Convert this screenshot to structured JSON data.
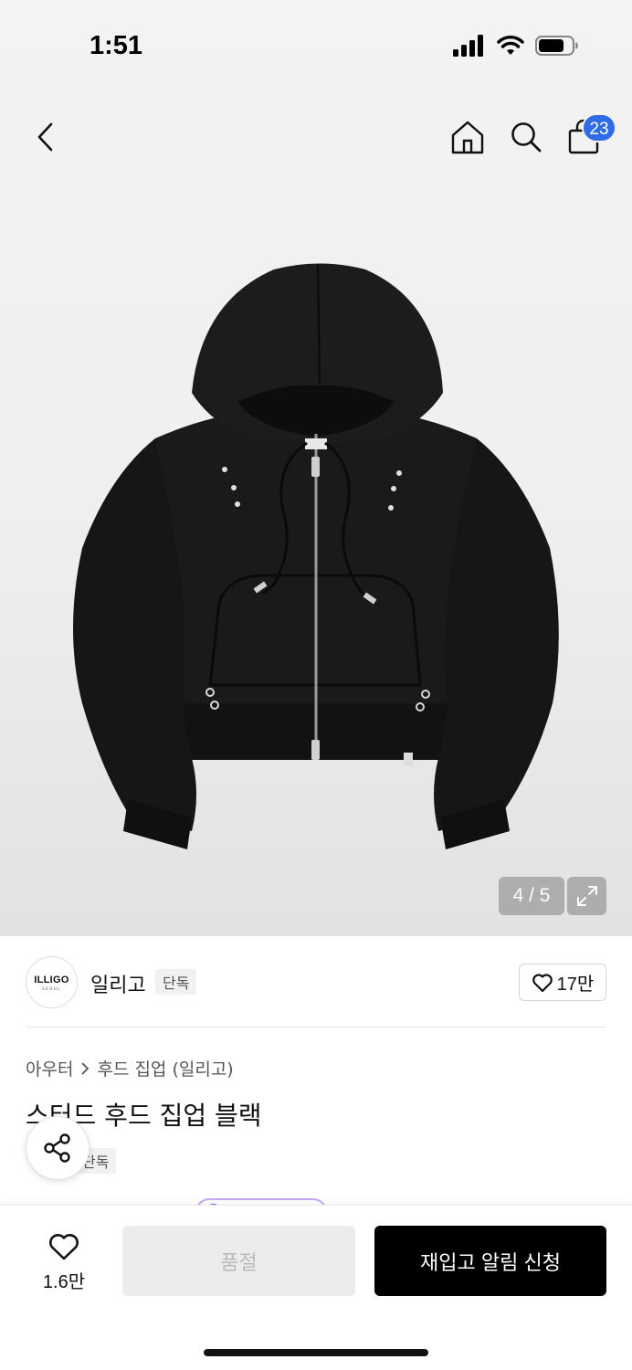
{
  "status_bar": {
    "time": "1:51"
  },
  "nav": {
    "back_icon": "chevron-left-icon",
    "home_icon": "home-icon",
    "search_icon": "search-icon",
    "cart_icon": "shopping-bag-icon",
    "cart_badge": "23",
    "cart_badge_color": "#2f6ce5"
  },
  "gallery": {
    "counter": "4 / 5",
    "expand_icon": "expand-icon"
  },
  "brand": {
    "logo_text": "ILLIGO",
    "logo_subtext": "SEOUL",
    "name": "일리고",
    "tag": "단독",
    "like_count": "17만"
  },
  "product": {
    "breadcrumb": [
      "아우터",
      "후드 집업 (일리고)"
    ],
    "title": "스터드 후드 집업 블랙",
    "tag": "단독"
  },
  "actions": {
    "wish_count": "1.6만",
    "soldout_label": "품절",
    "restock_label": "재입고 알림 신청",
    "share_icon": "share-icon"
  }
}
